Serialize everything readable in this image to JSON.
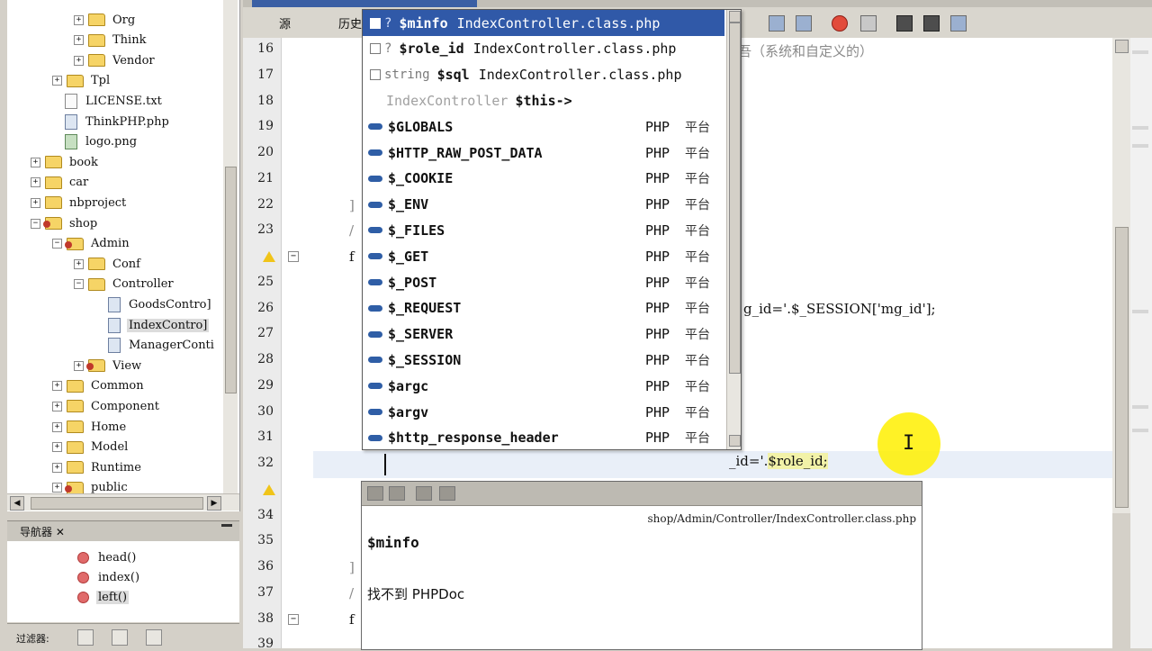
{
  "tree": {
    "items": [
      {
        "label": "Org",
        "icon": "folder-icon",
        "expander": "+",
        "indent": 1
      },
      {
        "label": "Think",
        "icon": "folder-icon",
        "expander": "+",
        "indent": 1
      },
      {
        "label": "Vendor",
        "icon": "folder-icon",
        "expander": "+",
        "indent": 1
      },
      {
        "label": "Tpl",
        "icon": "folder-icon",
        "expander": "+",
        "indent": 0
      },
      {
        "label": "LICENSE.txt",
        "icon": "file-icon",
        "expander": "",
        "indent": 0
      },
      {
        "label": "ThinkPHP.php",
        "icon": "php-file-icon",
        "expander": "",
        "indent": 0
      },
      {
        "label": "logo.png",
        "icon": "image-file-icon",
        "expander": "",
        "indent": 0
      },
      {
        "label": "book",
        "icon": "folder-icon",
        "expander": "+",
        "indent": -1
      },
      {
        "label": "car",
        "icon": "folder-icon",
        "expander": "+",
        "indent": -1
      },
      {
        "label": "nbproject",
        "icon": "folder-icon",
        "expander": "+",
        "indent": -1
      },
      {
        "label": "shop",
        "icon": "project-folder-icon",
        "expander": "-",
        "indent": -1
      },
      {
        "label": "Admin",
        "icon": "project-folder-icon",
        "expander": "-",
        "indent": 0
      },
      {
        "label": "Conf",
        "icon": "folder-icon",
        "expander": "+",
        "indent": 1
      },
      {
        "label": "Controller",
        "icon": "folder-icon",
        "expander": "-",
        "indent": 1
      },
      {
        "label": "GoodsContro]",
        "icon": "php-file-icon",
        "expander": "",
        "indent": 2
      },
      {
        "label": "IndexContro]",
        "icon": "php-file-icon",
        "expander": "",
        "indent": 2,
        "selected": true
      },
      {
        "label": "ManagerConti",
        "icon": "php-file-icon",
        "expander": "",
        "indent": 2
      },
      {
        "label": "View",
        "icon": "project-folder-icon",
        "expander": "+",
        "indent": 1
      },
      {
        "label": "Common",
        "icon": "folder-icon",
        "expander": "+",
        "indent": 0
      },
      {
        "label": "Component",
        "icon": "folder-icon",
        "expander": "+",
        "indent": 0
      },
      {
        "label": "Home",
        "icon": "folder-icon",
        "expander": "+",
        "indent": 0
      },
      {
        "label": "Model",
        "icon": "folder-icon",
        "expander": "+",
        "indent": 0
      },
      {
        "label": "Runtime",
        "icon": "folder-icon",
        "expander": "+",
        "indent": 0
      },
      {
        "label": "public",
        "icon": "project-folder-icon",
        "expander": "+",
        "indent": 0
      }
    ]
  },
  "navigator": {
    "tab_label": "导航器 ✕",
    "items": [
      {
        "label": "head()"
      },
      {
        "label": "index()"
      },
      {
        "label": "left()",
        "selected": true
      }
    ],
    "filter_label": "过滤器:"
  },
  "toolbar": {
    "source_label": "源",
    "history_label": "历史"
  },
  "editor": {
    "line_numbers": [
      "16",
      "17",
      "18",
      "19",
      "20",
      "21",
      "22",
      "23",
      "24",
      "25",
      "26",
      "27",
      "28",
      "29",
      "30",
      "31",
      "32",
      "33",
      "34",
      "35",
      "36",
      "37",
      "38",
      "39"
    ],
    "warning_lines": [
      "24",
      "33"
    ],
    "fold_lines": [
      "24",
      "38"
    ],
    "fragments": [
      {
        "line": "16",
        "text": "吾（系统和自定义的）",
        "gray": true,
        "col": "comment"
      },
      {
        "line": "22",
        "text": "]",
        "gray": true,
        "col": "brace"
      },
      {
        "line": "23",
        "text": "/",
        "gray": true,
        "col": "brace"
      },
      {
        "line": "24",
        "text": "f",
        "gray": false,
        "col": "brace"
      },
      {
        "line": "26",
        "text": "g_id='.$_SESSION['mg_id'];",
        "gray": false,
        "col": "after"
      },
      {
        "line": "36",
        "text": "]",
        "gray": true,
        "col": "brace"
      },
      {
        "line": "37",
        "text": "/",
        "gray": true,
        "col": "brace"
      },
      {
        "line": "38",
        "text": "f",
        "gray": false,
        "col": "brace"
      }
    ],
    "line31_prefix": "_id='.",
    "line31_var": "$role_id;"
  },
  "completion": {
    "context_rows": [
      {
        "q": "?",
        "name": "$minfo",
        "file": "IndexController.class.php",
        "selected": true
      },
      {
        "q": "?",
        "name": "$role_id",
        "file": "IndexController.class.php"
      },
      {
        "q": "string",
        "name": "$sql",
        "file": "IndexController.class.php"
      }
    ],
    "this_row": {
      "cls": "IndexController",
      "name": "$this->"
    },
    "globals": [
      {
        "name": "$GLOBALS",
        "lang": "PHP",
        "platform": "平台"
      },
      {
        "name": "$HTTP_RAW_POST_DATA",
        "lang": "PHP",
        "platform": "平台"
      },
      {
        "name": "$_COOKIE",
        "lang": "PHP",
        "platform": "平台"
      },
      {
        "name": "$_ENV",
        "lang": "PHP",
        "platform": "平台"
      },
      {
        "name": "$_FILES",
        "lang": "PHP",
        "platform": "平台"
      },
      {
        "name": "$_GET",
        "lang": "PHP",
        "platform": "平台"
      },
      {
        "name": "$_POST",
        "lang": "PHP",
        "platform": "平台"
      },
      {
        "name": "$_REQUEST",
        "lang": "PHP",
        "platform": "平台"
      },
      {
        "name": "$_SERVER",
        "lang": "PHP",
        "platform": "平台"
      },
      {
        "name": "$_SESSION",
        "lang": "PHP",
        "platform": "平台"
      },
      {
        "name": "$argc",
        "lang": "PHP",
        "platform": "平台"
      },
      {
        "name": "$argv",
        "lang": "PHP",
        "platform": "平台"
      },
      {
        "name": "$http_response_header",
        "lang": "PHP",
        "platform": "平台"
      }
    ]
  },
  "doc": {
    "path": "shop/Admin/Controller/IndexController.class.php",
    "title": "$minfo",
    "message": "找不到 PHPDoc"
  }
}
